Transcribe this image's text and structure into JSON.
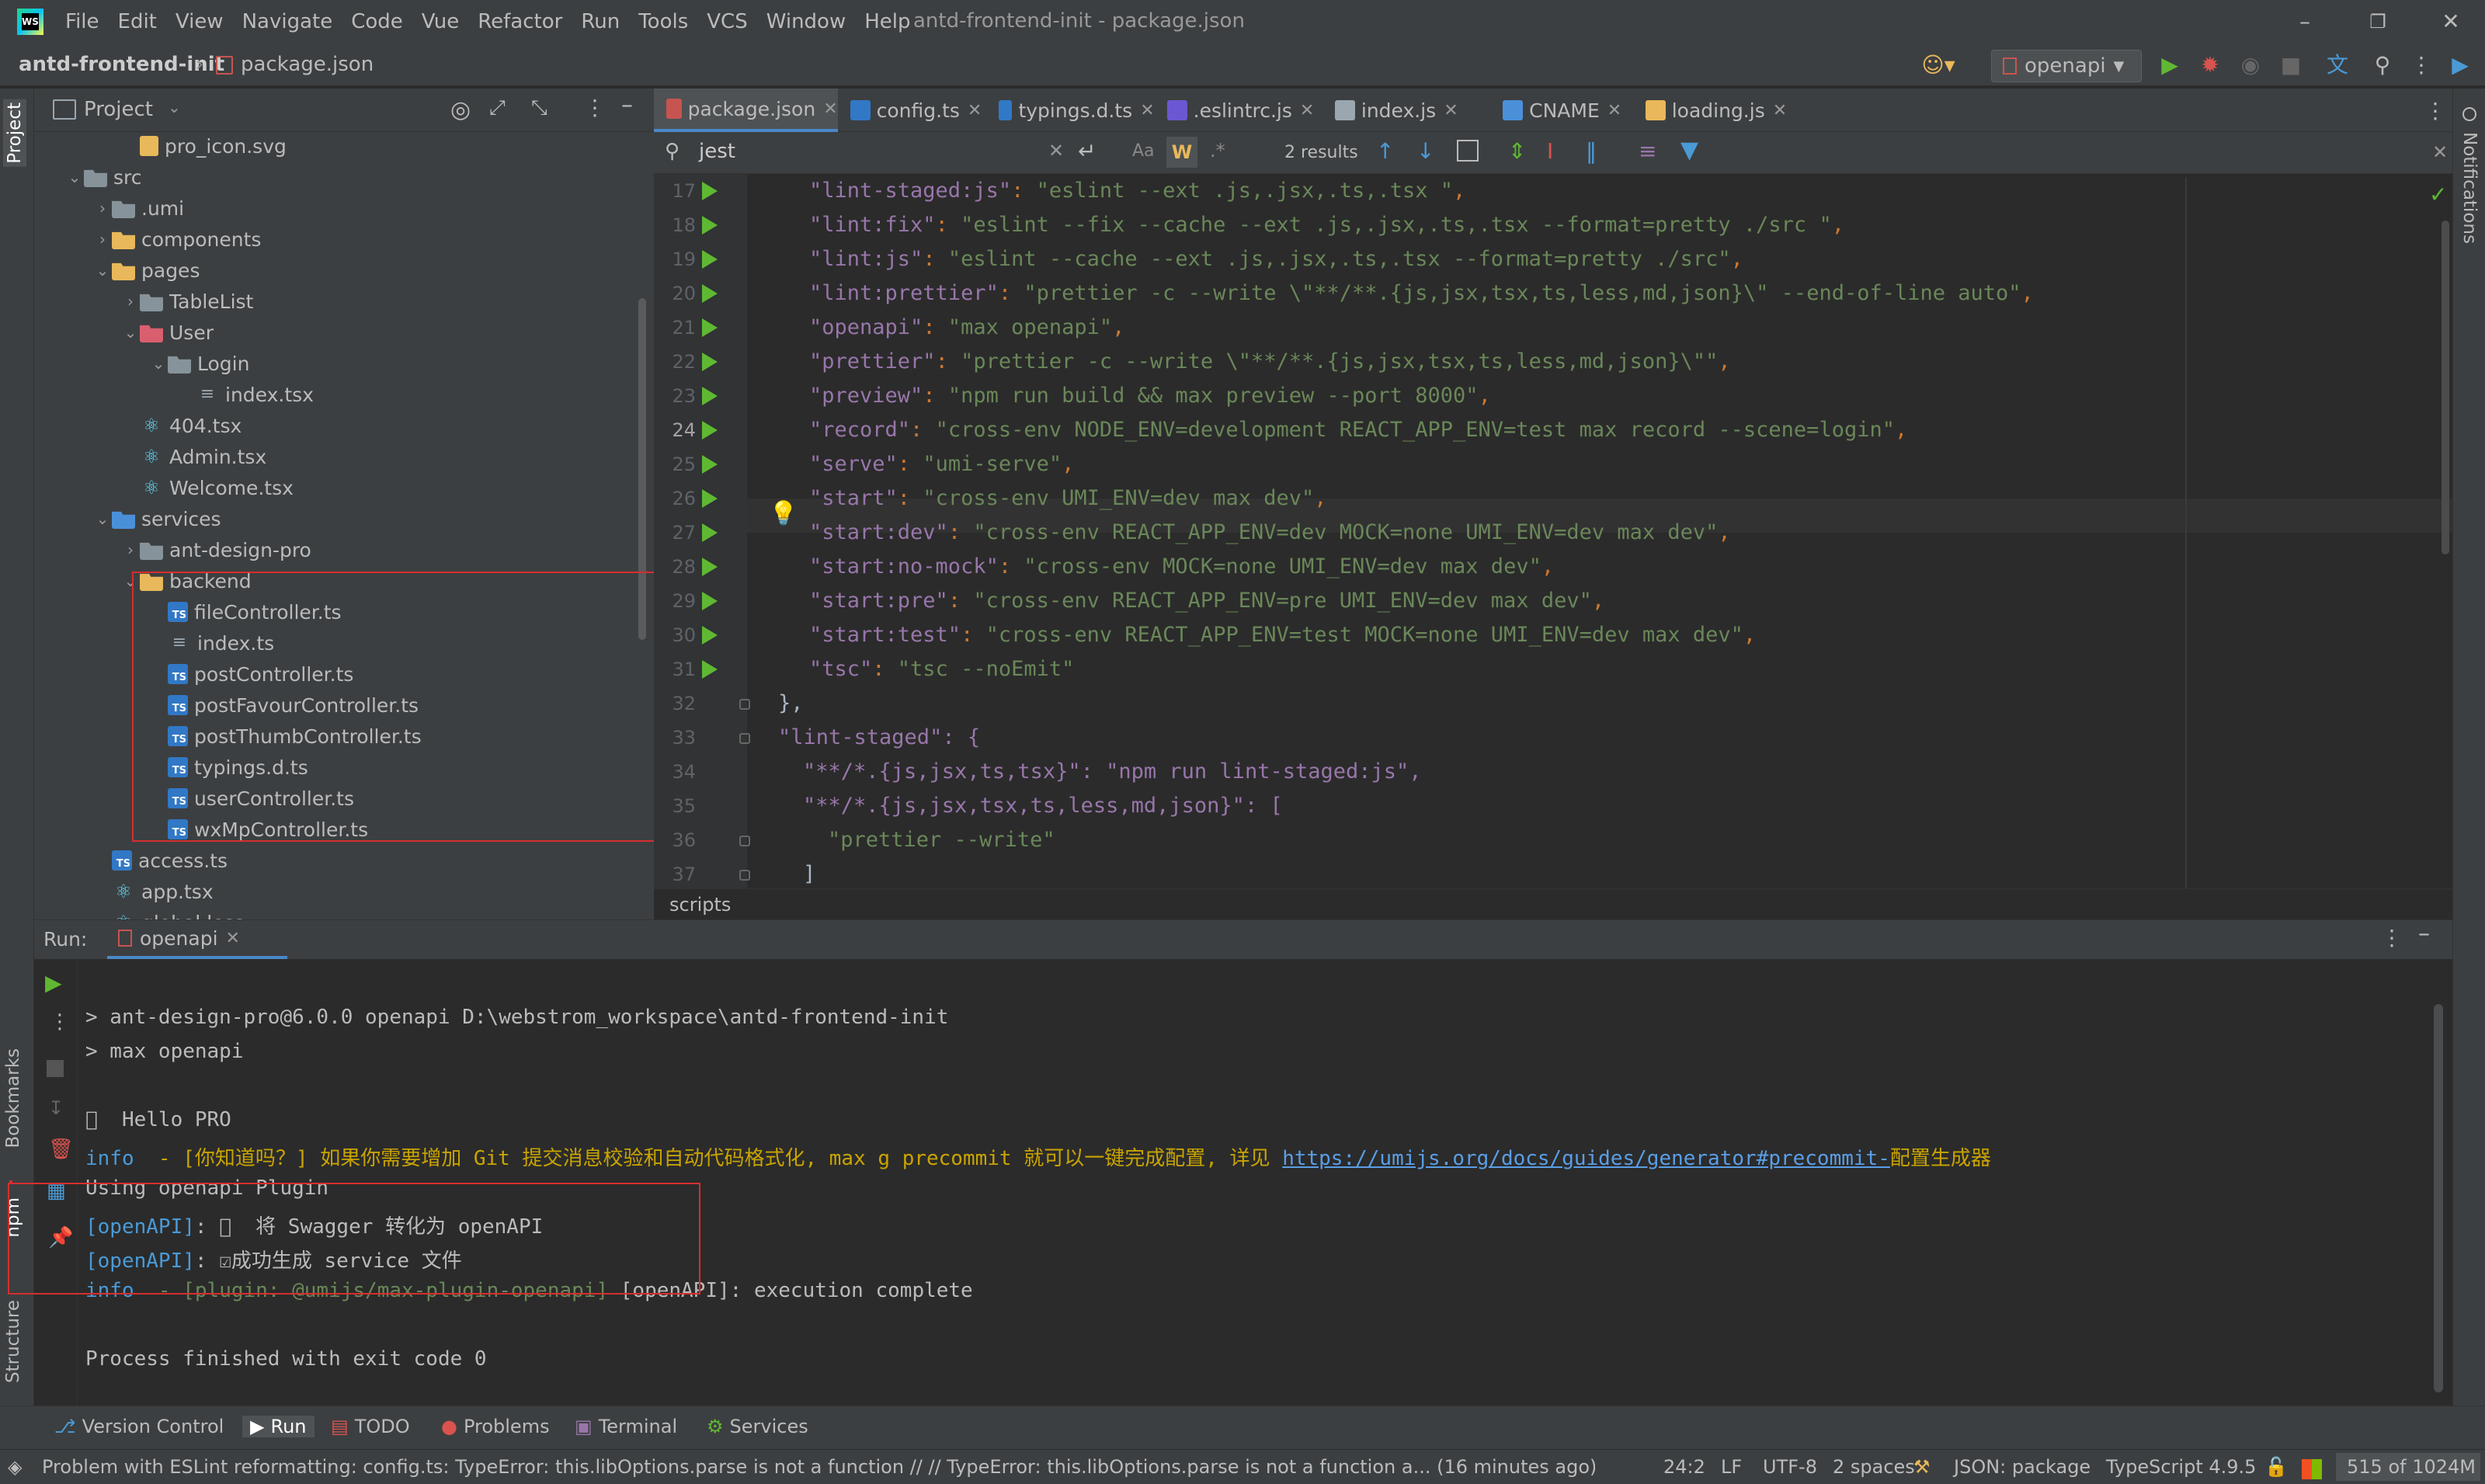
{
  "app": {
    "window_title": "antd-frontend-init - package.json",
    "menu": [
      "File",
      "Edit",
      "View",
      "Navigate",
      "Code",
      "Vue",
      "Refactor",
      "Run",
      "Tools",
      "VCS",
      "Window",
      "Help"
    ]
  },
  "navbar": {
    "project": "antd-frontend-init",
    "file": "package.json",
    "run_config": "openapi"
  },
  "project_panel": {
    "title": "Project",
    "tree": [
      {
        "label": "pro_icon.svg",
        "depth": 3,
        "icon": "svg-file-icon",
        "arrow": ""
      },
      {
        "label": "src",
        "depth": 1,
        "icon": "folder-icon",
        "arrow": "v"
      },
      {
        "label": ".umi",
        "depth": 2,
        "icon": "folder-icon",
        "arrow": ">"
      },
      {
        "label": "components",
        "depth": 2,
        "icon": "folder-yellow-icon",
        "arrow": ">"
      },
      {
        "label": "pages",
        "depth": 2,
        "icon": "folder-yellow-icon",
        "arrow": "v"
      },
      {
        "label": "TableList",
        "depth": 3,
        "icon": "folder-icon",
        "arrow": ">"
      },
      {
        "label": "User",
        "depth": 3,
        "icon": "folder-red-icon",
        "arrow": "v"
      },
      {
        "label": "Login",
        "depth": 4,
        "icon": "folder-icon",
        "arrow": "v"
      },
      {
        "label": "index.tsx",
        "depth": 5,
        "icon": "index-file-icon",
        "arrow": ""
      },
      {
        "label": "404.tsx",
        "depth": 3,
        "icon": "react-icon",
        "arrow": ""
      },
      {
        "label": "Admin.tsx",
        "depth": 3,
        "icon": "react-icon",
        "arrow": ""
      },
      {
        "label": "Welcome.tsx",
        "depth": 3,
        "icon": "react-icon",
        "arrow": ""
      },
      {
        "label": "services",
        "depth": 2,
        "icon": "folder-blue-icon",
        "arrow": "v"
      },
      {
        "label": "ant-design-pro",
        "depth": 3,
        "icon": "folder-icon",
        "arrow": ">"
      },
      {
        "label": "backend",
        "depth": 3,
        "icon": "folder-yellow-icon",
        "arrow": "v"
      },
      {
        "label": "fileController.ts",
        "depth": 4,
        "icon": "ts-file-icon",
        "arrow": ""
      },
      {
        "label": "index.ts",
        "depth": 4,
        "icon": "index-file-icon",
        "arrow": ""
      },
      {
        "label": "postController.ts",
        "depth": 4,
        "icon": "ts-file-icon",
        "arrow": ""
      },
      {
        "label": "postFavourController.ts",
        "depth": 4,
        "icon": "ts-file-icon",
        "arrow": ""
      },
      {
        "label": "postThumbController.ts",
        "depth": 4,
        "icon": "ts-file-icon",
        "arrow": ""
      },
      {
        "label": "typings.d.ts",
        "depth": 4,
        "icon": "ts-file-icon",
        "arrow": ""
      },
      {
        "label": "userController.ts",
        "depth": 4,
        "icon": "ts-file-icon",
        "arrow": ""
      },
      {
        "label": "wxMpController.ts",
        "depth": 4,
        "icon": "ts-file-icon",
        "arrow": ""
      },
      {
        "label": "access.ts",
        "depth": 2,
        "icon": "ts-file-icon",
        "arrow": ""
      },
      {
        "label": "app.tsx",
        "depth": 2,
        "icon": "react-icon",
        "arrow": ""
      },
      {
        "label": "global.less",
        "depth": 2,
        "icon": "less-file-icon",
        "arrow": ""
      }
    ]
  },
  "editor": {
    "tabs": [
      {
        "label": "package.json",
        "active": true,
        "color": "#c75450"
      },
      {
        "label": "config.ts",
        "active": false,
        "color": "#3178c6"
      },
      {
        "label": "typings.d.ts",
        "active": false,
        "color": "#3178c6"
      },
      {
        "label": ".eslintrc.js",
        "active": false,
        "color": "#6b57d2"
      },
      {
        "label": "index.js",
        "active": false,
        "color": "#9aa7b0"
      },
      {
        "label": "CNAME",
        "active": false,
        "color": "#4a90d9"
      },
      {
        "label": "loading.js",
        "active": false,
        "color": "#e8b85a"
      }
    ],
    "search": {
      "query": "jest",
      "results": "2 results"
    },
    "lines": [
      {
        "n": "17",
        "run": true,
        "key": "\"lint-staged:js\"",
        "val": "\"eslint --ext .js,.jsx,.ts,.tsx \"",
        "tail": ","
      },
      {
        "n": "18",
        "run": true,
        "key": "\"lint:fix\"",
        "val": "\"eslint --fix --cache --ext .js,.jsx,.ts,.tsx --format=pretty ./src \"",
        "tail": ","
      },
      {
        "n": "19",
        "run": true,
        "key": "\"lint:js\"",
        "val": "\"eslint --cache --ext .js,.jsx,.ts,.tsx --format=pretty ./src\"",
        "tail": ","
      },
      {
        "n": "20",
        "run": true,
        "key": "\"lint:prettier\"",
        "val": "\"prettier -c --write \\\"**/**.{js,jsx,tsx,ts,less,md,json}\\\" --end-of-line auto\"",
        "tail": ","
      },
      {
        "n": "21",
        "run": true,
        "key": "\"openapi\"",
        "val": "\"max openapi\"",
        "tail": ","
      },
      {
        "n": "22",
        "run": true,
        "key": "\"prettier\"",
        "val": "\"prettier -c --write \\\"**/**.{js,jsx,tsx,ts,less,md,json}\\\"\"",
        "tail": ","
      },
      {
        "n": "23",
        "run": true,
        "key": "\"preview\"",
        "val": "\"npm run build && max preview --port 8000\"",
        "tail": ","
      },
      {
        "n": "24",
        "run": true,
        "key": "\"record\"",
        "val": "\"cross-env NODE_ENV=development REACT_APP_ENV=test max record --scene=login\"",
        "tail": ","
      },
      {
        "n": "25",
        "run": true,
        "key": "\"serve\"",
        "val": "\"umi-serve\"",
        "tail": ","
      },
      {
        "n": "26",
        "run": true,
        "key": "\"start\"",
        "val": "\"cross-env UMI_ENV=dev max dev\"",
        "tail": ","
      },
      {
        "n": "27",
        "run": true,
        "key": "\"start:dev\"",
        "val": "\"cross-env REACT_APP_ENV=dev MOCK=none UMI_ENV=dev max dev\"",
        "tail": ","
      },
      {
        "n": "28",
        "run": true,
        "key": "\"start:no-mock\"",
        "val": "\"cross-env MOCK=none UMI_ENV=dev max dev\"",
        "tail": ","
      },
      {
        "n": "29",
        "run": true,
        "key": "\"start:pre\"",
        "val": "\"cross-env REACT_APP_ENV=pre UMI_ENV=dev max dev\"",
        "tail": ","
      },
      {
        "n": "30",
        "run": true,
        "key": "\"start:test\"",
        "val": "\"cross-env REACT_APP_ENV=test MOCK=none UMI_ENV=dev max dev\"",
        "tail": ","
      },
      {
        "n": "31",
        "run": true,
        "key": "\"tsc\"",
        "val": "\"tsc --noEmit\"",
        "tail": ""
      }
    ],
    "tail_lines": [
      {
        "n": "32",
        "text": "},",
        "indent": 1
      },
      {
        "n": "33",
        "text": "\"lint-staged\": {",
        "indent": 1
      },
      {
        "n": "34",
        "text": "\"**/*.{js,jsx,ts,tsx}\": \"npm run lint-staged:js\",",
        "indent": 2
      },
      {
        "n": "35",
        "text": "\"**/*.{js,jsx,tsx,ts,less,md,json}\": [",
        "indent": 2
      },
      {
        "n": "36",
        "text": "\"prettier --write\"",
        "indent": 3
      },
      {
        "n": "37",
        "text": "]",
        "indent": 2
      }
    ],
    "breadcrumb": "scripts"
  },
  "run_panel": {
    "label": "Run:",
    "tab": "openapi",
    "console": {
      "l1": "> ant-design-pro@6.0.0 openapi D:\\webstrom_workspace\\antd-frontend-init",
      "l2": "> max openapi",
      "l3": "\u0000  Hello PRO",
      "l4_info": "info",
      "l4_text": "  - [你知道吗？] 如果你需要增加 Git 提交消息校验和自动代码格式化, max g precommit 就可以一键完成配置, 详见 ",
      "l4_link": "https://umijs.org/docs/guides/generator#precommit-",
      "l4_tail": "配置生成器",
      "l5": "Using openapi Plugin",
      "l6_tag": "[openAPI]",
      "l6_text": ": \u0000  将 Swagger 转化为 openAPI",
      "l7_tag": "[openAPI]",
      "l7_text": ": ☑成功生成 service 文件",
      "l8_info": "info",
      "l8_mid": "  - [plugin: @umijs/max-plugin-openapi]",
      "l8_text": " [openAPI]: execution complete",
      "l9": "Process finished with exit code 0"
    }
  },
  "bottom_tabs": [
    "Version Control",
    "Run",
    "TODO",
    "Problems",
    "Terminal",
    "Services"
  ],
  "left_tabs": {
    "project": "Project",
    "bookmarks": "Bookmarks",
    "npm": "npm",
    "structure": "Structure"
  },
  "right_tabs": {
    "notifications": "Notifications"
  },
  "status": {
    "message": "Problem with ESLint reformatting: config.ts: TypeError: this.libOptions.parse is not a function // // TypeError: this.libOptions.parse is not a function    a... (16 minutes ago)",
    "position": "24:2",
    "line_sep": "LF",
    "encoding": "UTF-8",
    "indent": "2 spaces",
    "schema": "JSON: package",
    "ts": "TypeScript 4.9.5",
    "memory": "515 of 1024M"
  },
  "colors": {
    "accent": "#4a88c7",
    "run_green": "#5fb832",
    "annotation_red": "#d62e2e"
  }
}
